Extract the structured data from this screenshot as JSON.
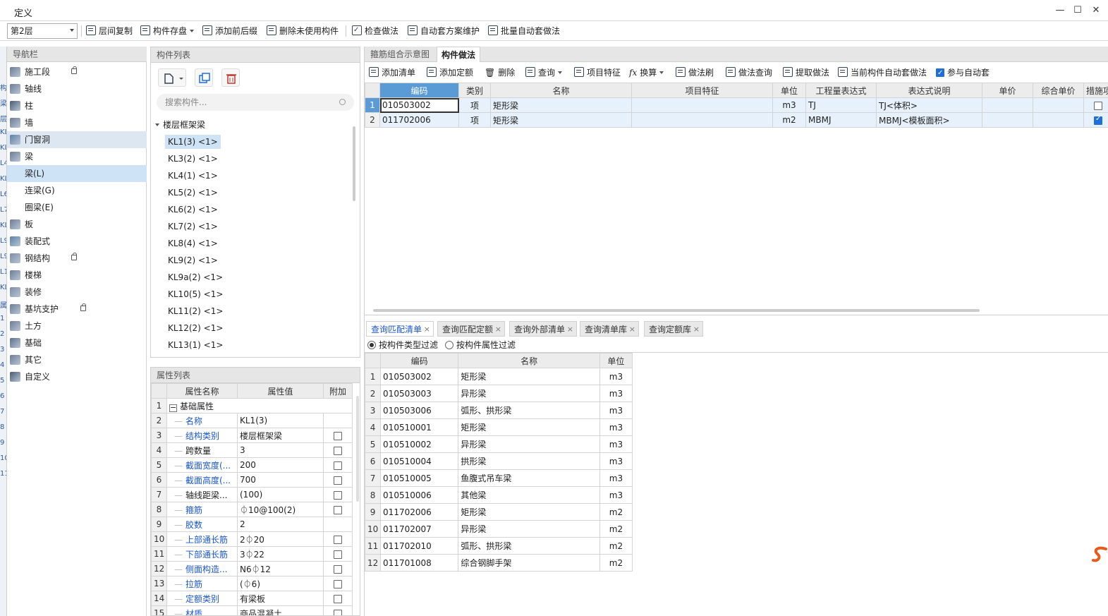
{
  "window": {
    "title": "定义"
  },
  "toolbar": {
    "floor": "第2层",
    "items": [
      "层间复制",
      "构件存盘",
      "添加前后缀",
      "删除未使用构件",
      "检查做法",
      "自动套方案维护",
      "批量自动套做法"
    ]
  },
  "nav": {
    "header": "导航栏",
    "items": [
      {
        "label": "施工段",
        "lock": true
      },
      {
        "label": "轴线"
      },
      {
        "label": "柱"
      },
      {
        "label": "墙"
      },
      {
        "label": "门窗洞"
      },
      {
        "label": "梁"
      },
      {
        "label": "梁(L)",
        "sub": true,
        "selected": true
      },
      {
        "label": "连梁(G)",
        "sub": true
      },
      {
        "label": "圈梁(E)",
        "sub": true
      },
      {
        "label": "板"
      },
      {
        "label": "装配式"
      },
      {
        "label": "钢结构",
        "lock": true
      },
      {
        "label": "楼梯"
      },
      {
        "label": "装修"
      },
      {
        "label": "基坑支护",
        "lock": true
      },
      {
        "label": "土方"
      },
      {
        "label": "基础"
      },
      {
        "label": "其它"
      },
      {
        "label": "自定义"
      }
    ]
  },
  "leftstrip": [
    "构",
    "梁",
    "层",
    "KL",
    "KL",
    "L4",
    "KL",
    "L6",
    "L7",
    "KL",
    "L9",
    "L9",
    "L1",
    "KL",
    "属",
    "1",
    "2",
    "3",
    "4",
    "5",
    "6",
    "7",
    "8",
    "9",
    "10",
    "11"
  ],
  "complist": {
    "header": "构件列表",
    "search_placeholder": "搜索构件...",
    "group": "楼层框架梁",
    "items": [
      "KL1(3) <1>",
      "KL3(2) <1>",
      "KL4(1) <1>",
      "KL5(2) <1>",
      "KL6(2) <1>",
      "KL7(2) <1>",
      "KL8(4) <1>",
      "KL9(2) <1>",
      "KL9a(2) <1>",
      "KL10(5) <1>",
      "KL11(2) <1>",
      "KL12(2) <1>",
      "KL13(1) <1>"
    ]
  },
  "proplist": {
    "header": "属性列表",
    "columns": [
      "属性名称",
      "属性值",
      "附加"
    ],
    "group_label": "基础属性",
    "rows": [
      {
        "n": "2",
        "name": "名称",
        "value": "KL1(3)",
        "blue": true,
        "cb": false
      },
      {
        "n": "3",
        "name": "结构类别",
        "value": "楼层框架梁",
        "blue": true,
        "cb": true
      },
      {
        "n": "4",
        "name": "跨数量",
        "value": "3",
        "blue": false,
        "cb": true
      },
      {
        "n": "5",
        "name": "截面宽度(...",
        "value": "200",
        "blue": true,
        "cb": true
      },
      {
        "n": "6",
        "name": "截面高度(...",
        "value": "700",
        "blue": true,
        "cb": true
      },
      {
        "n": "7",
        "name": "轴线距梁...",
        "value": "(100)",
        "blue": false,
        "cb": true
      },
      {
        "n": "8",
        "name": "箍筋",
        "value": "⏀10@100(2)",
        "blue": true,
        "cb": true
      },
      {
        "n": "9",
        "name": "胶数",
        "value": "2",
        "blue": true,
        "cb": false
      },
      {
        "n": "10",
        "name": "上部通长筋",
        "value": "2⏀20",
        "blue": true,
        "cb": true
      },
      {
        "n": "11",
        "name": "下部通长筋",
        "value": "3⏀22",
        "blue": true,
        "cb": true
      },
      {
        "n": "12",
        "name": "侧面构造...",
        "value": "N6⏀12",
        "blue": true,
        "cb": true
      },
      {
        "n": "13",
        "name": "拉筋",
        "value": "(⏀6)",
        "blue": true,
        "cb": true
      },
      {
        "n": "14",
        "name": "定额类别",
        "value": "有梁板",
        "blue": true,
        "cb": true
      },
      {
        "n": "15",
        "name": "材质",
        "value": "商品混凝土",
        "blue": true,
        "cb": true
      }
    ]
  },
  "right": {
    "tabs": [
      "箍筋组合示意图",
      "构件做法"
    ],
    "toolbar": [
      "添加清单",
      "添加定额",
      "删除",
      "查询",
      "项目特征",
      "换算",
      "做法刷",
      "做法查询",
      "提取做法",
      "当前构件自动套做法",
      "参与自动套"
    ],
    "method_columns": [
      "编码",
      "类别",
      "名称",
      "项目特征",
      "单位",
      "工程量表达式",
      "表达式说明",
      "单价",
      "综合单价",
      "措施项"
    ],
    "methods": [
      {
        "n": "1",
        "code": "010503002",
        "cat": "项",
        "name": "矩形梁",
        "feature": "",
        "unit": "m3",
        "expr": "TJ",
        "desc": "TJ<体积>",
        "price": "",
        "total": "",
        "measure": false
      },
      {
        "n": "2",
        "code": "011702006",
        "cat": "项",
        "name": "矩形梁",
        "feature": "",
        "unit": "m2",
        "expr": "MBMJ",
        "desc": "MBMJ<模板面积>",
        "price": "",
        "total": "",
        "measure": true
      }
    ],
    "query_tabs": [
      "查询匹配清单",
      "查询匹配定额",
      "查询外部清单",
      "查询清单库",
      "查询定额库"
    ],
    "filters": [
      "按构件类型过滤",
      "按构件属性过滤"
    ],
    "query_columns": [
      "编码",
      "名称",
      "单位"
    ],
    "query_rows": [
      {
        "n": "1",
        "code": "010503002",
        "name": "矩形梁",
        "unit": "m3"
      },
      {
        "n": "2",
        "code": "010503003",
        "name": "异形梁",
        "unit": "m3"
      },
      {
        "n": "3",
        "code": "010503006",
        "name": "弧形、拱形梁",
        "unit": "m3"
      },
      {
        "n": "4",
        "code": "010510001",
        "name": "矩形梁",
        "unit": "m3"
      },
      {
        "n": "5",
        "code": "010510002",
        "name": "异形梁",
        "unit": "m3"
      },
      {
        "n": "6",
        "code": "010510004",
        "name": "拱形梁",
        "unit": "m3"
      },
      {
        "n": "7",
        "code": "010510005",
        "name": "鱼腹式吊车梁",
        "unit": "m3"
      },
      {
        "n": "8",
        "code": "010510006",
        "name": "其他梁",
        "unit": "m3"
      },
      {
        "n": "9",
        "code": "011702006",
        "name": "矩形梁",
        "unit": "m2"
      },
      {
        "n": "10",
        "code": "011702007",
        "name": "异形梁",
        "unit": "m2"
      },
      {
        "n": "11",
        "code": "011702010",
        "name": "弧形、拱形梁",
        "unit": "m2"
      },
      {
        "n": "12",
        "code": "011701008",
        "name": "综合钢脚手架",
        "unit": "m2"
      }
    ]
  },
  "colors": {
    "accent": "#1e6fd9",
    "selection": "#cfe3f7",
    "link": "#1a56c9",
    "header": "#e6e6e6"
  }
}
